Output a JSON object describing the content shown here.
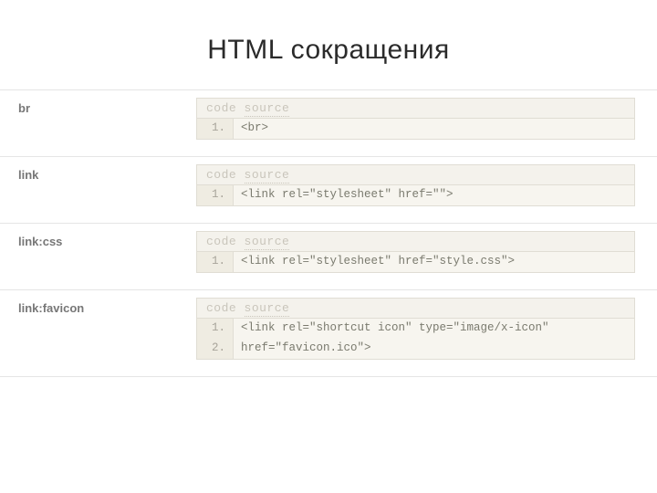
{
  "title": "HTML сокращения",
  "header_tab_code": "code",
  "header_tab_source": "source",
  "rows": [
    {
      "abbrev": "br",
      "lines": [
        {
          "n": "1.",
          "text": "<br>"
        }
      ]
    },
    {
      "abbrev": "link",
      "lines": [
        {
          "n": "1.",
          "text": "<link rel=\"stylesheet\" href=\"\">"
        }
      ]
    },
    {
      "abbrev": "link:css",
      "lines": [
        {
          "n": "1.",
          "text": "<link rel=\"stylesheet\" href=\"style.css\">"
        }
      ]
    },
    {
      "abbrev": "link:favicon",
      "lines": [
        {
          "n": "1.",
          "text": "<link rel=\"shortcut icon\" type=\"image/x-icon\""
        },
        {
          "n": "2.",
          "text": "href=\"favicon.ico\">"
        }
      ]
    }
  ]
}
